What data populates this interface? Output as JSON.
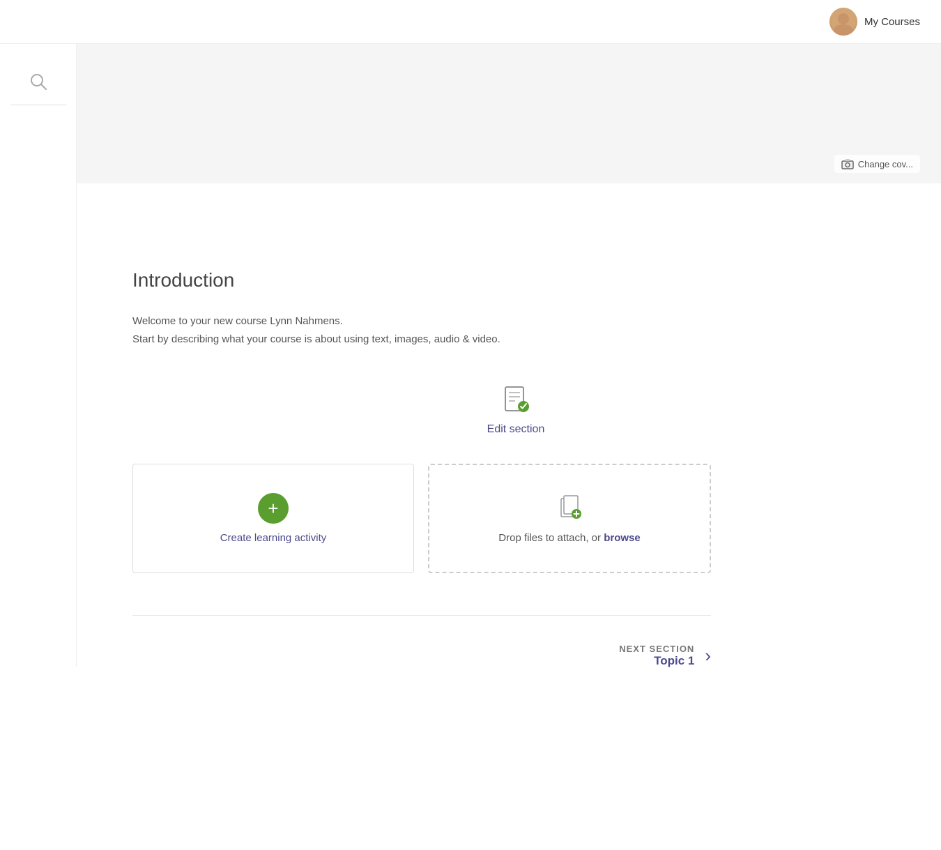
{
  "header": {
    "my_courses_label": "My Courses"
  },
  "hero": {
    "change_cover_label": "Change cov..."
  },
  "sidebar": {
    "search_placeholder": "Search"
  },
  "main": {
    "section_title": "Introduction",
    "welcome_line1": "Welcome to your new course Lynn Nahmens.",
    "welcome_line2": "Start by describing what your course is about using text, images, audio & video.",
    "edit_section_label": "Edit section",
    "create_activity_label": "Create learning activity",
    "drop_files_text": "Drop files to attach, or ",
    "browse_label": "browse",
    "next_section_label": "NEXT SECTION",
    "next_section_name": "Topic 1"
  },
  "colors": {
    "accent": "#4a4a8c",
    "green": "#5a9e2f",
    "border": "#ddd",
    "text_muted": "#777"
  }
}
